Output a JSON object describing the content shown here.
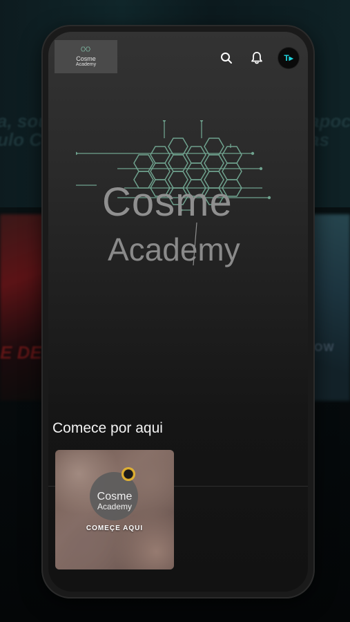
{
  "background": {
    "promo_left_1": "a, sou",
    "promo_left_2": "ulo C",
    "promo_right_1": "apoc",
    "promo_right_2": "as",
    "promo_red": "E DE",
    "promo_row": "OW"
  },
  "header": {
    "logo_line1": "Cosme",
    "logo_line2": "Academy",
    "avatar_initials": "T▸"
  },
  "hero": {
    "title": "Cosme",
    "subtitle": "Academy"
  },
  "section": {
    "title": "Comece por aqui"
  },
  "card": {
    "logo_line1": "Cosme",
    "logo_line2": "Academy",
    "cta": "COMEÇE AQUI"
  },
  "colors": {
    "accent": "#1fd7e0",
    "circuit": "#6fa28e",
    "text_muted": "#8f8f8f"
  },
  "icons": [
    "search-icon",
    "bell-icon",
    "avatar"
  ]
}
